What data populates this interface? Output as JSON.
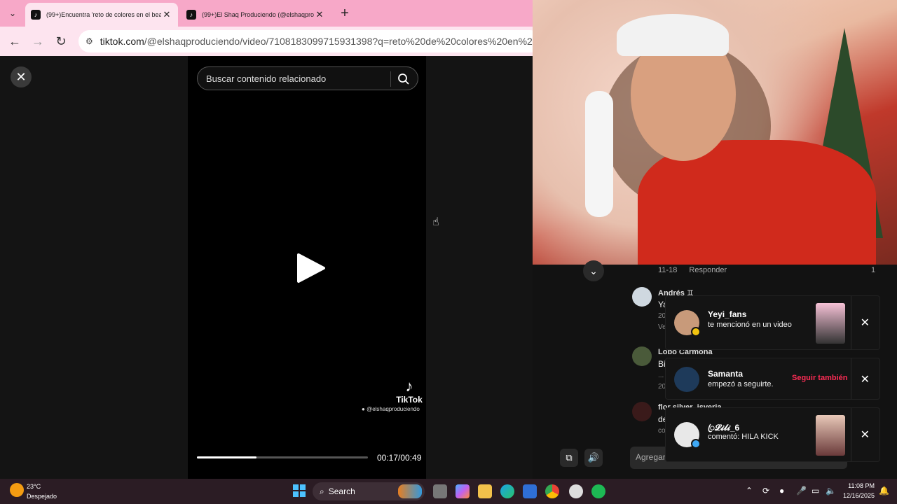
{
  "browser": {
    "tabs": [
      {
        "title": "(99+)Encuentra 'reto de colores en el beat",
        "favicon": "tiktok-icon",
        "active": true
      },
      {
        "title": "(99+)El Shaq Produciendo (@elshaqprodu",
        "favicon": "tiktok-icon",
        "active": false
      }
    ],
    "url_domain": "tiktok.com",
    "url_path": "/@elshaqproduciendo/video/7108183099715931398?q=reto%20de%20colores%20en%20el%20b"
  },
  "video": {
    "search_placeholder": "Buscar contenido relacionado",
    "tiktok_word": "TikTok",
    "username": "@elshaqproduciendo",
    "time": "00:17/00:49",
    "progress": 0.35
  },
  "comments": {
    "first_meta_date": "11-18",
    "reply_label": "Responder",
    "first_count": "1",
    "items": [
      {
        "name": "Andrés ♊",
        "text": "Ya",
        "sub": "20",
        "sub2": "Ve"
      },
      {
        "name": "Lobo Carmona",
        "text": "Bi",
        "sub": "...",
        "sub2": "20"
      },
      {
        "name": "flor silver_jsveria",
        "text": "de",
        "sub": "co",
        "sub2": ""
      }
    ],
    "input_placeholder": "Agregar c"
  },
  "notifications": [
    {
      "name": "Yeyi_fans",
      "message": "te mencionó en un video"
    },
    {
      "name": "Samanta",
      "message": "empezó a seguirte.",
      "action": "Seguir también"
    },
    {
      "name": "ꦿ𝓛𝓲𝓵𝓲_6",
      "message": "comentó: HILA KICK"
    }
  ],
  "taskbar": {
    "temperature": "23°C",
    "condition": "Despejado",
    "search_label": "Search",
    "time": "11:08 PM",
    "date": "12/16/2025"
  },
  "colors": {
    "tab_bar": "#f7a8c8",
    "address_bar": "#fde4ef",
    "tiktok_red": "#fe2c55",
    "taskbar": "#2b1c24"
  }
}
